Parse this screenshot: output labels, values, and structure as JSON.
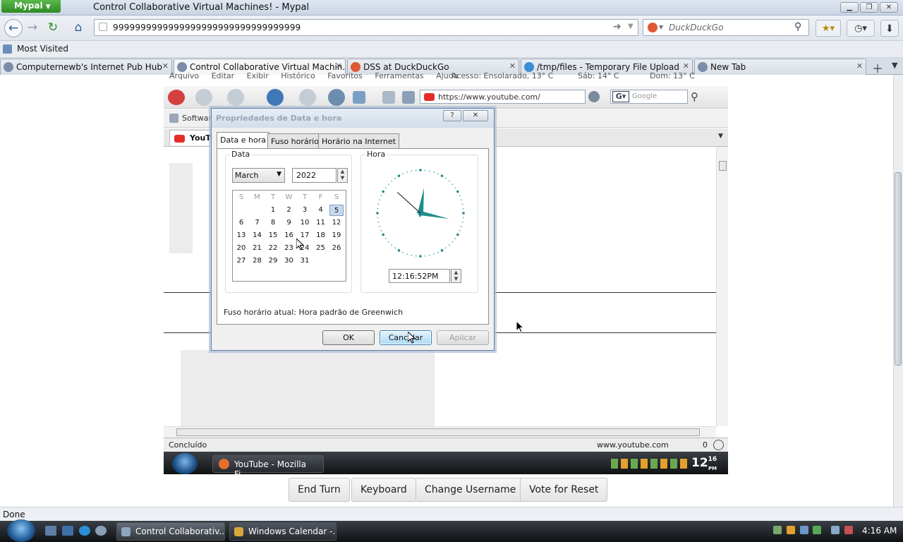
{
  "browser": {
    "app_button": "Mypal",
    "window_title": "Control Collaborative Virtual Machines! - Mypal",
    "url": "9999999999999999999999999999999999",
    "search_placeholder": "DuckDuckGo",
    "bookmark_most_visited": "Most Visited",
    "tabs": [
      {
        "label": "Computernewb's Internet Pub Hub"
      },
      {
        "label": "Control Collaborative Virtual Machin..."
      },
      {
        "label": "DSS at DuckDuckGo"
      },
      {
        "label": "/tmp/files - Temporary File Upload"
      },
      {
        "label": "New Tab"
      }
    ],
    "status": "Done"
  },
  "vm": {
    "menu": "Arquivo Editar Exibir Histórico Favoritos Ferramentas Ajuda",
    "menu_weather1": "Acesso: Ensolarado, 13° C",
    "menu_weather2": "Sáb: 14° C",
    "menu_weather3": "Dom: 13° C",
    "url": "https://www.youtube.com/",
    "search_placeholder": "Google",
    "bookmark": "Software",
    "tab": "YouTube",
    "status_left": "Concluído",
    "status_url": "www.youtube.com",
    "status_count": "0",
    "taskbar_window": "YouTube - Mozilla Fi...",
    "clock_hour": "12",
    "clock_min": "16",
    "clock_ampm": "PM"
  },
  "dialog": {
    "title": "Propriedades de Data e hora",
    "help": "?",
    "close": "✕",
    "tabs": [
      "Data e hora",
      "Fuso horário",
      "Horário na Internet"
    ],
    "date_group": "Data",
    "time_group": "Hora",
    "month": "March",
    "year": "2022",
    "weekdays": [
      "S",
      "M",
      "T",
      "W",
      "T",
      "F",
      "S"
    ],
    "days": [
      [
        "",
        "",
        "1",
        "2",
        "3",
        "4",
        "5"
      ],
      [
        "6",
        "7",
        "8",
        "9",
        "10",
        "11",
        "12"
      ],
      [
        "13",
        "14",
        "15",
        "16",
        "17",
        "18",
        "19"
      ],
      [
        "20",
        "21",
        "22",
        "23",
        "24",
        "25",
        "26"
      ],
      [
        "27",
        "28",
        "29",
        "30",
        "31",
        "",
        ""
      ]
    ],
    "selected_day": "5",
    "time": "12:16:52PM",
    "timezone_label": "Fuso horário atual:",
    "timezone_value": "Hora padrão de Greenwich",
    "ok": "OK",
    "cancel": "Cancelar",
    "apply": "Aplicar"
  },
  "controls": {
    "end_turn": "End Turn",
    "keyboard": "Keyboard",
    "change_username": "Change Username",
    "vote_reset": "Vote for Reset"
  },
  "taskbar": {
    "items": [
      "Control Collaborativ...",
      "Windows Calendar -..."
    ],
    "time": "4:16 AM"
  },
  "colors": {
    "accent": "#3c7fb1",
    "clock_hands": "#1f8c8a",
    "taskbar": "#1a1d21"
  }
}
